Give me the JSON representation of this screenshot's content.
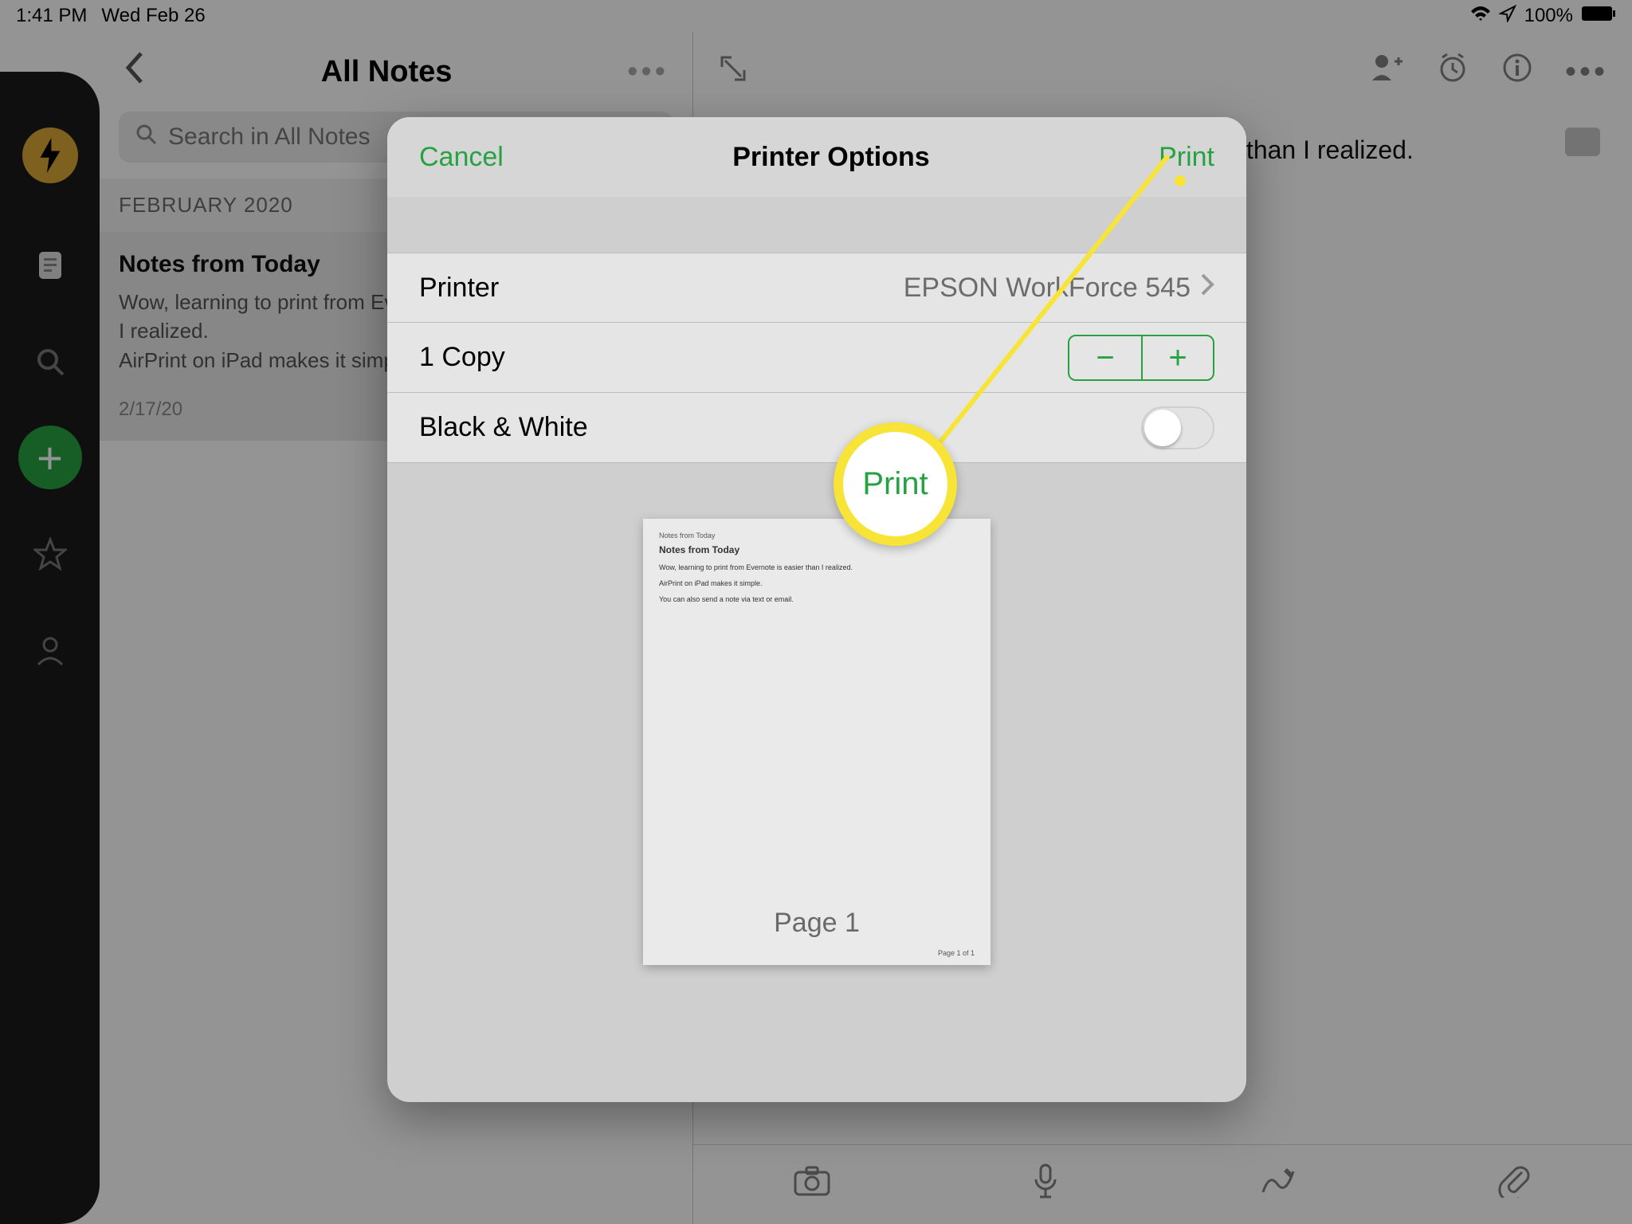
{
  "status": {
    "time": "1:41 PM",
    "date": "Wed Feb 26",
    "battery_pct": "100%"
  },
  "notes_app": {
    "list_title": "All Notes",
    "search_placeholder": "Search in All Notes",
    "section_header": "FEBRUARY 2020",
    "note": {
      "title": "Notes from Today",
      "preview_line1": "Wow, learning to print from Evernote is easier than",
      "preview_line2": "I realized.",
      "preview_line3": "AirPrint on iPad makes it simple.",
      "date": "2/17/20"
    },
    "detail_body": "Wow, learning to print from Evernote is easier than I realized."
  },
  "print_dialog": {
    "cancel": "Cancel",
    "title": "Printer Options",
    "print": "Print",
    "rows": {
      "printer_label": "Printer",
      "printer_value": "EPSON WorkForce 545",
      "copies_label": "1 Copy",
      "bw_label": "Black & White",
      "bw_on": false
    },
    "preview": {
      "small_title": "Notes from Today",
      "page_title": "Notes from Today",
      "line1": "Wow, learning to print from Evernote is easier than I realized.",
      "line2": "AirPrint on iPad makes it simple.",
      "line3": "You can also send a note via text or email.",
      "footer": "Page 1 of 1",
      "page_label": "Page 1"
    }
  },
  "callout": {
    "label": "Print"
  }
}
